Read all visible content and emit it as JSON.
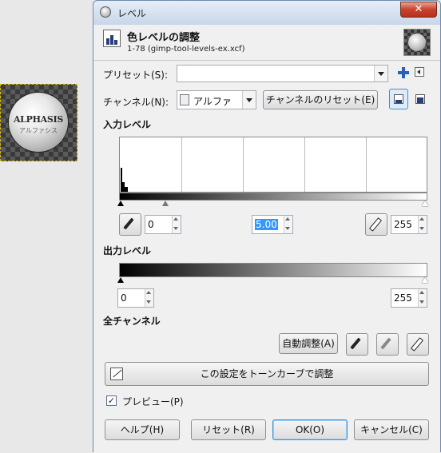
{
  "thumbnail": {
    "title": "ALPHASIS",
    "subtitle": "アルファシス"
  },
  "window": {
    "title": "レベル",
    "close_label": "✕"
  },
  "header": {
    "title": "色レベルの調整",
    "subtitle": "1-78 (gimp-tool-levels-ex.xcf)"
  },
  "preset": {
    "label": "プリセット(S):",
    "value": ""
  },
  "channel": {
    "label": "チャンネル(N):",
    "value": "アルファ",
    "reset_label": "チャンネルのリセット(E)"
  },
  "input_levels": {
    "label": "入力レベル",
    "low": "0",
    "gamma": "5.00",
    "high": "255"
  },
  "output_levels": {
    "label": "出力レベル",
    "low": "0",
    "high": "255"
  },
  "all_channels": {
    "label": "全チャンネル",
    "auto_label": "自動調整(A)"
  },
  "curves_button": {
    "label": "この設定をトーンカーブで調整"
  },
  "preview": {
    "label": "プレビュー(P)",
    "checked": true
  },
  "buttons": {
    "help": "ヘルプ(H)",
    "reset": "リセット(R)",
    "ok": "OK(O)",
    "cancel": "キャンセル(C)"
  }
}
